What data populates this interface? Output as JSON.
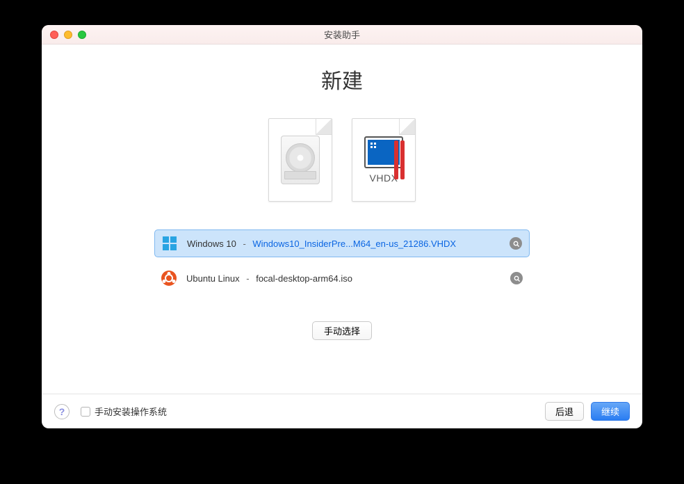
{
  "window": {
    "title": "安装助手"
  },
  "heading": "新建",
  "vhdx_label": "VHDX",
  "list": {
    "items": [
      {
        "os": "Windows 10",
        "filename": "Windows10_InsiderPre...M64_en-us_21286.VHDX",
        "selected": true,
        "icon": "windows"
      },
      {
        "os": "Ubuntu Linux",
        "filename": "focal-desktop-arm64.iso",
        "selected": false,
        "icon": "ubuntu"
      }
    ]
  },
  "manual_select": "手动选择",
  "footer": {
    "help": "?",
    "checkbox_label": "手动安装操作系统",
    "back": "后退",
    "continue": "继续"
  }
}
